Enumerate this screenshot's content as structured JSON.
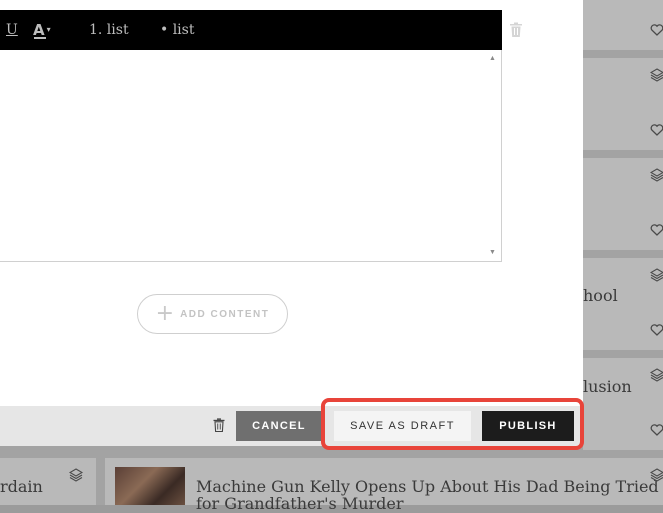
{
  "toolbar": {
    "underline_label": "U",
    "text_color_label": "A",
    "text_color_caret": "▾",
    "ordered_list_label": "1. list",
    "bullet_list_label": "• list"
  },
  "editor": {
    "scroll_up": "▲",
    "scroll_down": "▼"
  },
  "add_content": {
    "plus": "+",
    "label": "ADD CONTENT"
  },
  "footer": {
    "cancel_label": "CANCEL",
    "save_draft_label": "SAVE AS DRAFT",
    "publish_label": "PUBLISH"
  },
  "background": {
    "card_text_1": "hool",
    "card_text_2": "lusion",
    "bottom_left_text": "rdain",
    "headline_line1": "Machine Gun Kelly Opens Up About His Dad Being Tried",
    "headline_line2": "for Grandfather's Murder"
  },
  "colors": {
    "highlight": "#e8443a",
    "publish_bg": "#1c1c1c",
    "cancel_bg": "#6f6f6f",
    "toolbar_bg": "#000000"
  },
  "icons": {
    "layers": "layers-icon",
    "heart": "heart-icon",
    "trash": "trash-icon"
  }
}
